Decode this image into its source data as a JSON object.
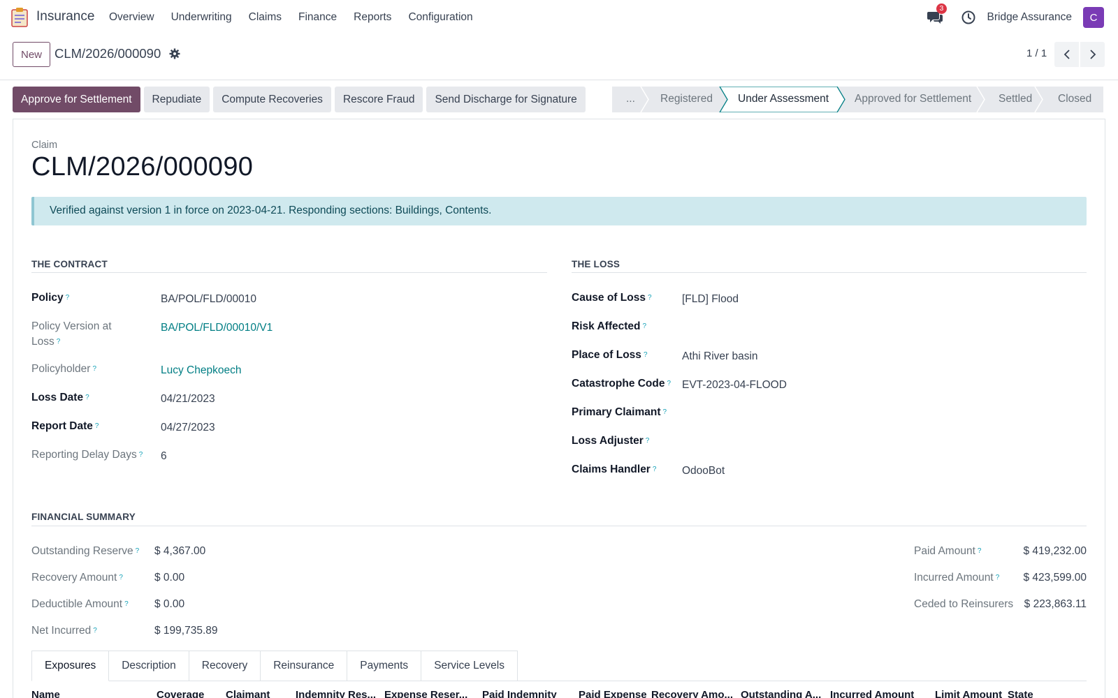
{
  "navbar": {
    "app_name": "Insurance",
    "menu": [
      "Overview",
      "Underwriting",
      "Claims",
      "Finance",
      "Reports",
      "Configuration"
    ],
    "chat_count": "3",
    "company": "Bridge Assurance",
    "avatar_initial": "C",
    "avatar_color": "#7a3bb5"
  },
  "control": {
    "new_label": "New",
    "record_name": "CLM/2026/000090",
    "pager": "1 / 1"
  },
  "actions": {
    "approve": "Approve for Settlement",
    "repudiate": "Repudiate",
    "compute": "Compute Recoveries",
    "rescore": "Rescore Fraud",
    "send_discharge": "Send Discharge for Signature"
  },
  "statusbar": {
    "more": "...",
    "stages": [
      "Registered",
      "Under Assessment",
      "Approved for Settlement",
      "Settled",
      "Closed"
    ],
    "active_stage": "Under Assessment"
  },
  "form": {
    "type_label": "Claim",
    "title": "CLM/2026/000090",
    "alert": "Verified against version 1 in force on 2023-04-21. Responding sections: Buildings, Contents."
  },
  "contract": {
    "heading": "THE CONTRACT",
    "policy_label": "Policy",
    "policy": "BA/POL/FLD/00010",
    "version_label_1": "Policy Version at",
    "version_label_2": "Loss",
    "version": "BA/POL/FLD/00010/V1",
    "policyholder_label": "Policyholder",
    "policyholder": "Lucy Chepkoech",
    "loss_date_label": "Loss Date",
    "loss_date": "04/21/2023",
    "report_date_label": "Report Date",
    "report_date": "04/27/2023",
    "delay_label": "Reporting Delay Days",
    "delay": "6"
  },
  "loss": {
    "heading": "THE LOSS",
    "cause_label": "Cause of Loss",
    "cause": "[FLD] Flood",
    "risk_label": "Risk Affected",
    "place_label": "Place of Loss",
    "place": "Athi River basin",
    "cat_label": "Catastrophe Code",
    "cat": "EVT-2023-04-FLOOD",
    "claimant_label": "Primary Claimant",
    "adjuster_label": "Loss Adjuster",
    "handler_label": "Claims Handler",
    "handler": "OdooBot"
  },
  "financial": {
    "heading": "FINANCIAL SUMMARY",
    "outstanding_label": "Outstanding Reserve",
    "outstanding": "$ 4,367.00",
    "recovery_label": "Recovery Amount",
    "recovery": "$ 0.00",
    "deductible_label": "Deductible Amount",
    "deductible": "$ 0.00",
    "net_label": "Net Incurred",
    "net": "$ 199,735.89",
    "paid_label": "Paid Amount",
    "paid": "$ 419,232.00",
    "incurred_label": "Incurred Amount",
    "incurred": "$ 423,599.00",
    "ceded_label": "Ceded to Reinsurers",
    "ceded": "$ 223,863.11"
  },
  "tabs": [
    "Exposures",
    "Description",
    "Recovery",
    "Reinsurance",
    "Payments",
    "Service Levels"
  ],
  "table_columns": [
    "Name",
    "Coverage",
    "Claimant",
    "Indemnity Res...",
    "Expense Reser...",
    "Paid Indemnity",
    "Paid Expense",
    "Recovery Amo...",
    "Outstanding A...",
    "Incurred Amount",
    "Limit Amount",
    "State"
  ]
}
